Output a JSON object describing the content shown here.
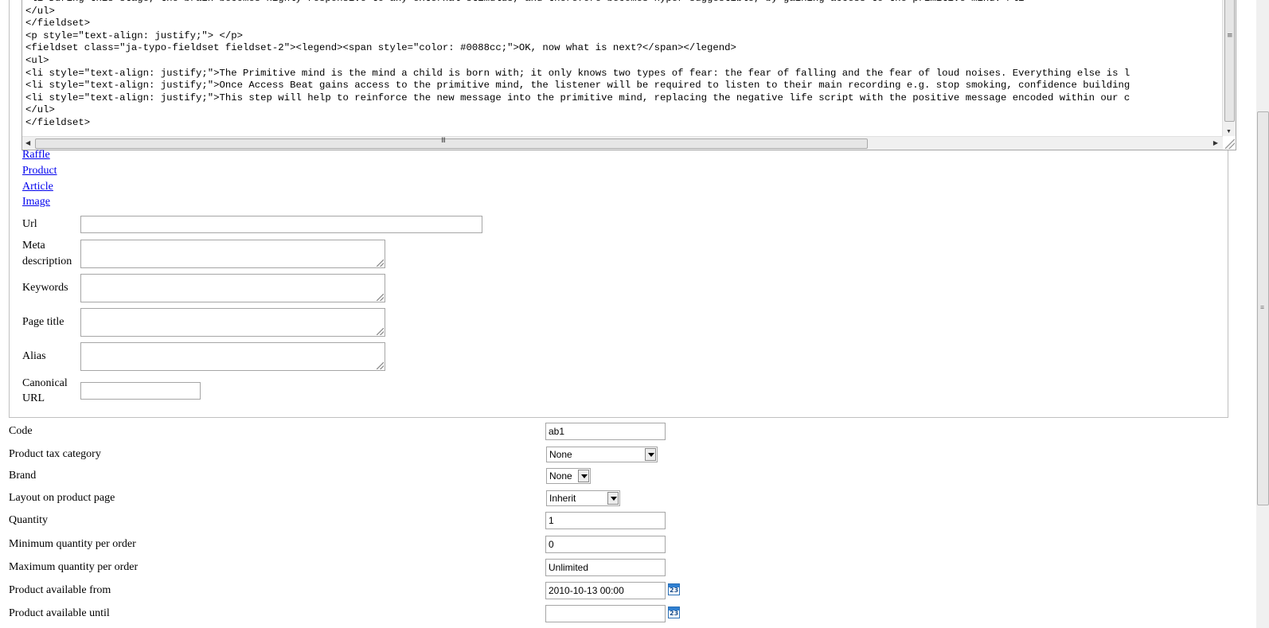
{
  "code_editor": {
    "lines": [
      "<li>During this stage, the brain becomes highly responsive to any external stimulus, and therefore becomes hyper-suggestible, by gaining access to the primitive mind.</li>",
      "</ul>",
      "</fieldset>",
      "<p style=\"text-align: justify;\"> </p>",
      "<fieldset class=\"ja-typo-fieldset fieldset-2\"><legend><span style=\"color: #0088cc;\">OK, now what is next?</span></legend>",
      "<ul>",
      "<li style=\"text-align: justify;\">The Primitive mind is the mind a child is born with; it only knows two types of fear: the fear of falling and the fear of loud noises. Everything else is l",
      "<li style=\"text-align: justify;\">Once Access Beat gains access to the primitive mind, the listener will be required to listen to their main recording e.g. stop smoking, confidence building",
      "<li style=\"text-align: justify;\">This step will help to reinforce the new message into the primitive mind, replacing the negative life script with the positive message encoded within our c",
      "</ul>",
      "</fieldset>"
    ]
  },
  "links": [
    "Raffle",
    "Product",
    "Article",
    "Image"
  ],
  "seo": {
    "url_label": "Url",
    "url_value": "",
    "meta_description_label_1": "Meta",
    "meta_description_label_2": "description",
    "keywords_label": "Keywords",
    "page_title_label": "Page title",
    "alias_label": "Alias",
    "canonical_label_1": "Canonical",
    "canonical_label_2": "URL"
  },
  "product": {
    "code_label": "Code",
    "code_value": "ab1",
    "tax_label": "Product tax category",
    "tax_value": "None",
    "brand_label": "Brand",
    "brand_value": "None",
    "layout_label": "Layout on product page",
    "layout_value": "Inherit",
    "quantity_label": "Quantity",
    "quantity_value": "1",
    "min_qty_label": "Minimum quantity per order",
    "min_qty_value": "0",
    "max_qty_label": "Maximum quantity per order",
    "max_qty_value": "Unlimited",
    "available_from_label": "Product available from",
    "available_from_value": "2010-10-13 00:00",
    "available_until_label": "Product available until",
    "available_until_value": "",
    "calendar_icon_text": "23"
  },
  "icons": {
    "calendar": "calendar-icon",
    "scroll_grip": "≡",
    "hscroll_grip": "III"
  }
}
